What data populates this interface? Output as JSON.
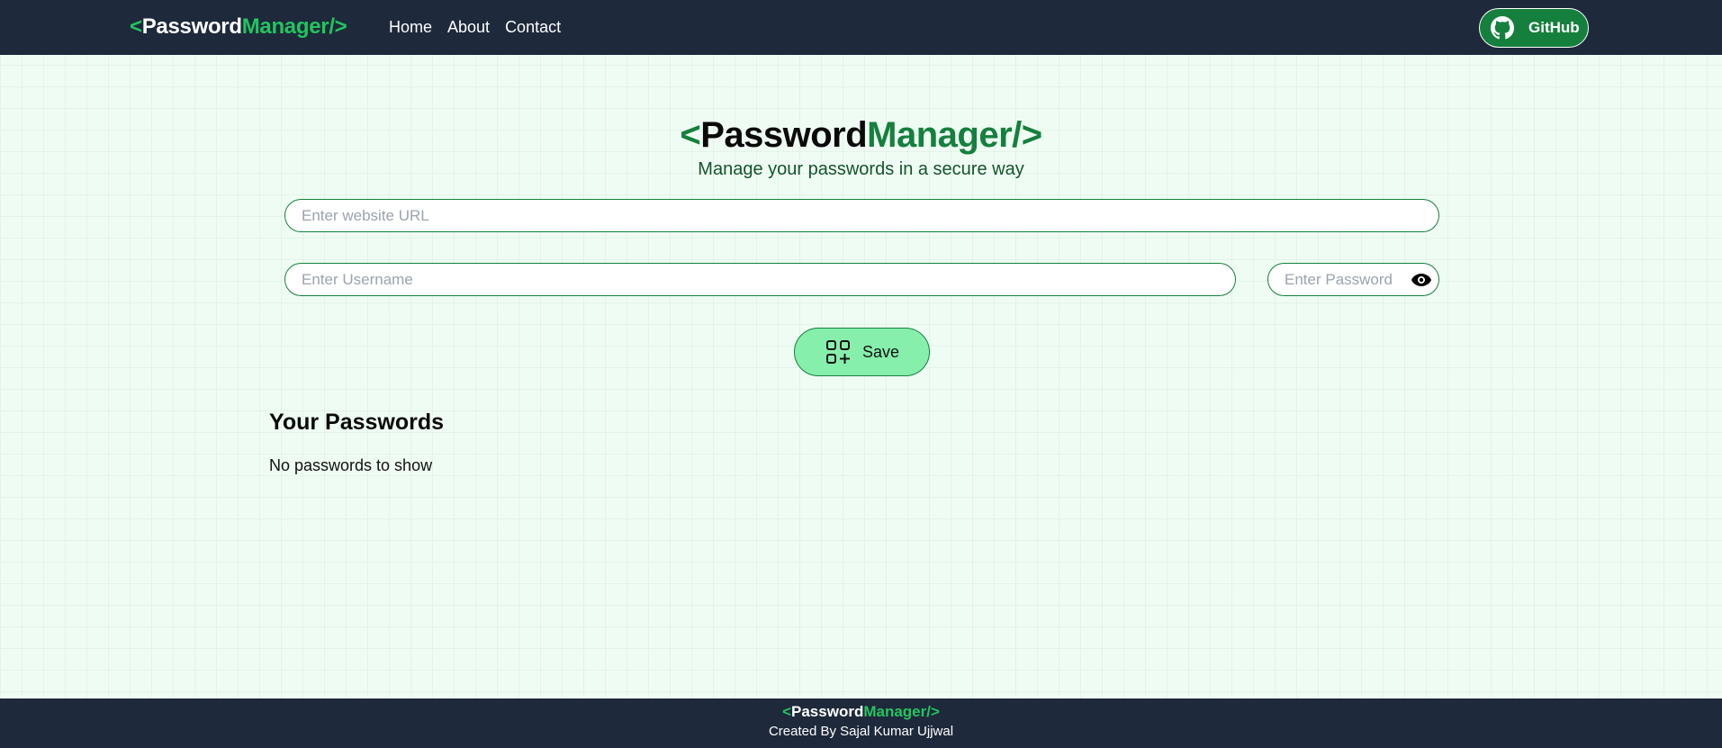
{
  "nav": {
    "logo": {
      "open": "<",
      "word1": "Password",
      "word2": "Manager",
      "close": "/>"
    },
    "links": [
      "Home",
      "About",
      "Contact"
    ],
    "github_label": "GitHub"
  },
  "hero": {
    "title": {
      "open": "<",
      "word1": "Password",
      "word2": "Manager",
      "close": "/>"
    },
    "subtitle": "Manage your passwords in a secure way"
  },
  "form": {
    "url_placeholder": "Enter website URL",
    "url_value": "",
    "username_placeholder": "Enter Username",
    "username_value": "",
    "password_placeholder": "Enter Password",
    "password_value": "",
    "save_label": "Save"
  },
  "passwords": {
    "heading": "Your Passwords",
    "empty_text": "No passwords to show"
  },
  "footer": {
    "logo": {
      "open": "<",
      "word1": "Password",
      "word2": "Manager",
      "close": "/>"
    },
    "credit": "Created By Sajal Kumar Ujjwal"
  },
  "icons": {
    "github": "github-icon",
    "eye": "eye-icon",
    "save": "add-grid-icon"
  },
  "colors": {
    "navbar_bg": "#1e293b",
    "accent_green": "#22c55e",
    "dark_green": "#15803d",
    "button_green": "#86efac",
    "page_bg": "#effcf3"
  }
}
